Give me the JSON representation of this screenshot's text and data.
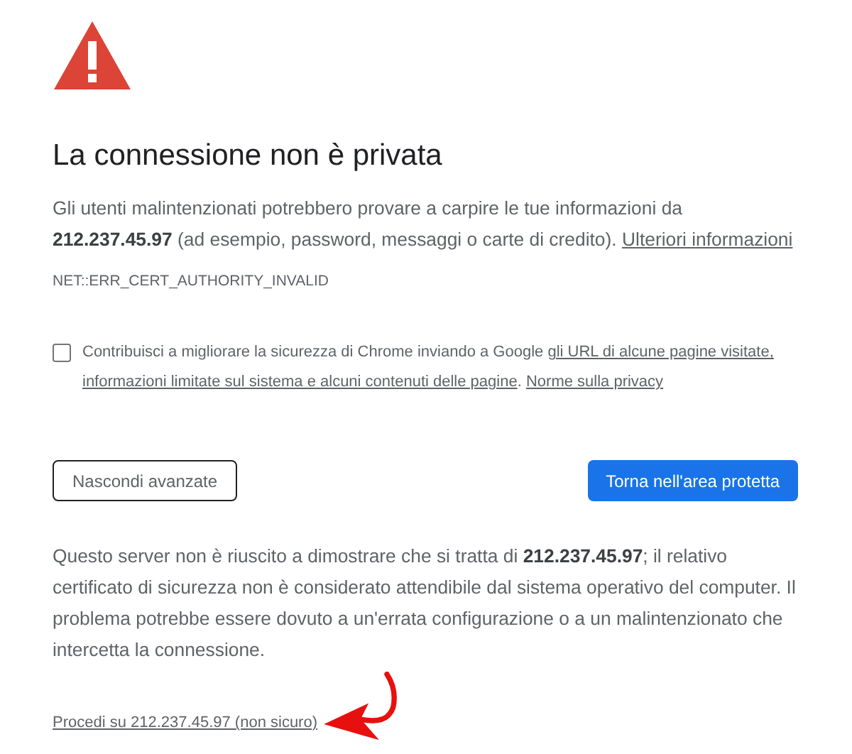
{
  "title": "La connessione non è privata",
  "intro": {
    "text": "Gli utenti malintenzionati potrebbero provare a carpire le tue informazioni da **212.237.45.97** (ad esempio, password, messaggi o carte di credito).",
    "link": "Ulteriori informazioni"
  },
  "error_code": "NET::ERR_CERT_AUTHORITY_INVALID",
  "opt_in": {
    "checked": false,
    "segments": [
      {
        "kind": "text",
        "text": "Contribuisci a migliorare la sicurezza di Chrome inviando a Google "
      },
      {
        "kind": "link",
        "text": "gli URL di alcune pagine visitate,"
      },
      {
        "kind": "link",
        "text": "informazioni limitate sul sistema e alcuni contenuti delle pagine"
      },
      {
        "kind": "text",
        "text": ". "
      },
      {
        "kind": "link",
        "text": "Norme sulla privacy"
      }
    ]
  },
  "buttons": [
    {
      "label": "Nascondi avanzate",
      "kind": "secondary"
    },
    {
      "label": "Torna nell'area protetta",
      "kind": "primary"
    }
  ],
  "details": "Questo server non è riuscito a dimostrare che si tratta di **212.237.45.97**; il relativo certificato di sicurezza non è considerato attendibile dal sistema operativo del computer. Il problema potrebbe essere dovuto a un'errata configurazione o a un malintenzionato che intercetta la connessione.",
  "proceed_link": "Procedi su 212.237.45.97 (non sicuro)"
}
